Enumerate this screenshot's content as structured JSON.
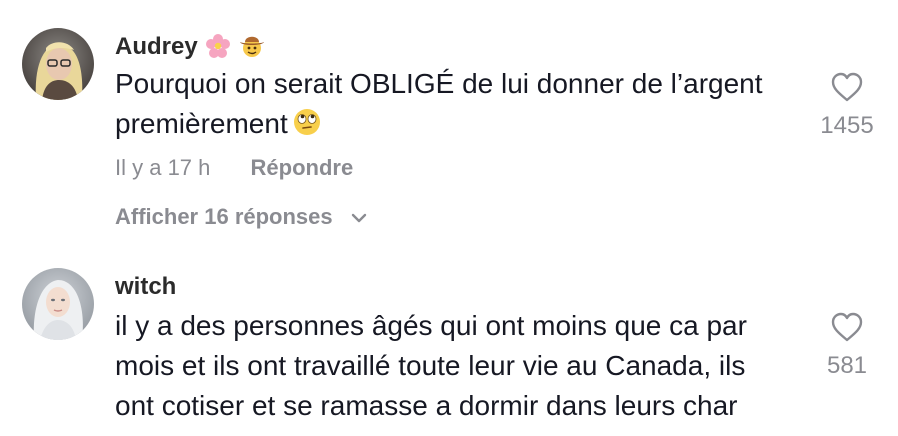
{
  "comments": [
    {
      "username": "Audrey",
      "username_emojis": [
        "cherry-blossom-emoji",
        "cowboy-face-emoji"
      ],
      "text_lines": [
        "Pourquoi on serait OBLIGÉ de lui donner de l’argent",
        "premièrement"
      ],
      "text_emoji": "face-with-rolling-eyes-emoji",
      "timestamp": "Il y a 17 h",
      "reply_label": "Répondre",
      "view_replies_label": "Afficher 16 réponses",
      "like_count": "1455",
      "like_icon": "heart-outline-icon"
    },
    {
      "username": "witch",
      "text_lines": [
        "il y a des personnes âgés qui ont moins que ca par",
        "mois et ils ont travaillé toute leur vie au Canada, ils",
        "ont cotiser et se ramasse a dormir dans leurs char"
      ],
      "like_count": "581",
      "like_icon": "heart-outline-icon"
    }
  ],
  "colors": {
    "text": "#161823",
    "username": "#2b2b2b",
    "muted": "#8a8b91",
    "background": "#ffffff"
  }
}
